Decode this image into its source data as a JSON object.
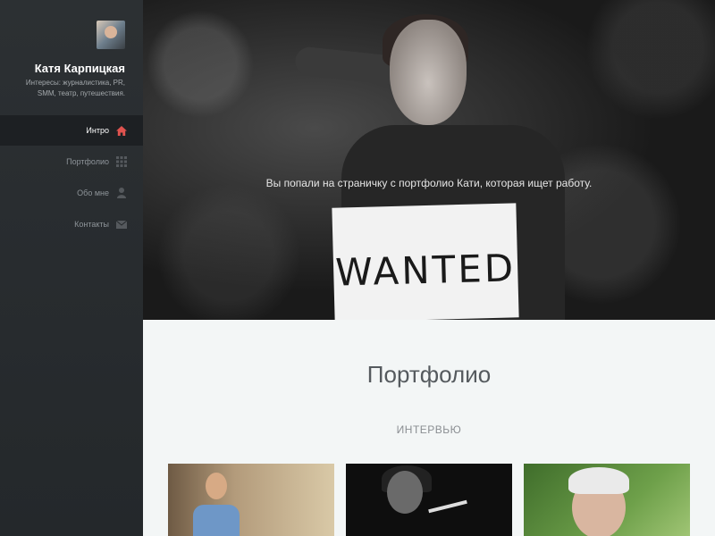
{
  "sidebar": {
    "avatar_icon": "user-photo",
    "name": "Катя Карпицкая",
    "bio": "Интересы: журналистика, PR, SMM, театр, путешествия.",
    "nav": [
      {
        "label": "Интро",
        "icon": "home-icon",
        "active": true
      },
      {
        "label": "Портфолио",
        "icon": "grid-icon",
        "active": false
      },
      {
        "label": "Обо мне",
        "icon": "user-icon",
        "active": false
      },
      {
        "label": "Контакты",
        "icon": "envelope-icon",
        "active": false
      }
    ],
    "accent_color": "#e0534f"
  },
  "hero": {
    "caption": "Вы попали на страничку с портфолио Кати, которая ищет работу.",
    "sign_text": "WANTED"
  },
  "portfolio": {
    "title": "Портфолио",
    "section_label": "ИНТЕРВЬЮ"
  }
}
